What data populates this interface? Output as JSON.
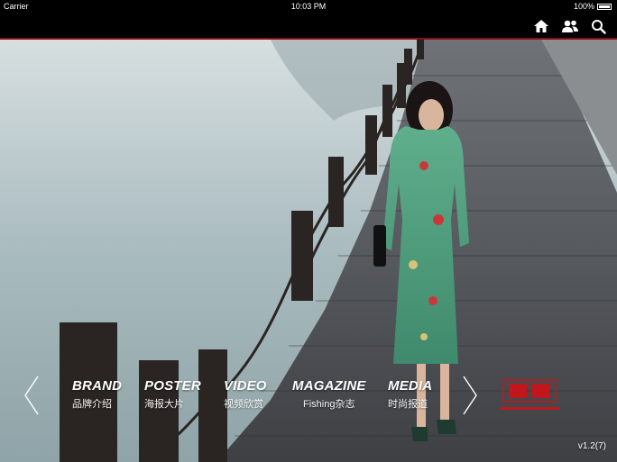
{
  "status_bar": {
    "carrier": "Carrier",
    "time": "10:03 PM",
    "battery": "100%"
  },
  "nav": {
    "icons": [
      "home-icon",
      "users-icon",
      "search-icon"
    ]
  },
  "menu": {
    "items": [
      {
        "en": "BRAND",
        "zh": "品牌介绍"
      },
      {
        "en": "POSTER",
        "zh": "海报大片"
      },
      {
        "en": "VIDEO",
        "zh": "视频欣赏"
      },
      {
        "en": "MAGAZINE",
        "zh": "Fishing杂志"
      },
      {
        "en": "MEDIA",
        "zh": "时尚报道"
      }
    ]
  },
  "version": "v1.2(7)",
  "colors": {
    "accent_red": "#8a0d12",
    "logo_red": "#c0171d"
  }
}
